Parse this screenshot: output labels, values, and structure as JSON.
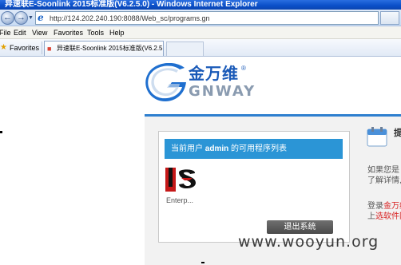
{
  "window": {
    "title": "异速联E-Soonlink 2015标准版(V6.2.5.0) - Windows Internet Explorer",
    "address": "http://124.202.240.190:8088/Web_sc/programs.gn"
  },
  "menu": {
    "items": [
      "File",
      "Edit",
      "View",
      "Favorites",
      "Tools",
      "Help"
    ]
  },
  "favorites_bar": {
    "favorites_label": "Favorites",
    "tab_title": "异速联E-Soonlink 2015标准版(V6.2.5.0)"
  },
  "logo": {
    "cn": "金万维",
    "en": "GNWAY",
    "reg": "®"
  },
  "program_box": {
    "header_pre": "当前用户",
    "user": "admin",
    "header_post": "的可用程序列表",
    "app_label": "Enterp..."
  },
  "logout_label": "退出系统",
  "side": {
    "title": "提",
    "line1": "如果您是",
    "line2": "了解详情,",
    "line3_pre": "登录",
    "line3_hl": "金万纬",
    "line4_pre": "上",
    "line4_hl": "选软件网"
  },
  "watermark": "www.wooyun.org",
  "colors": {
    "header_blue": "#2b95d6",
    "accent_rule": "#2e7fcf",
    "link_red": "#d82020"
  }
}
